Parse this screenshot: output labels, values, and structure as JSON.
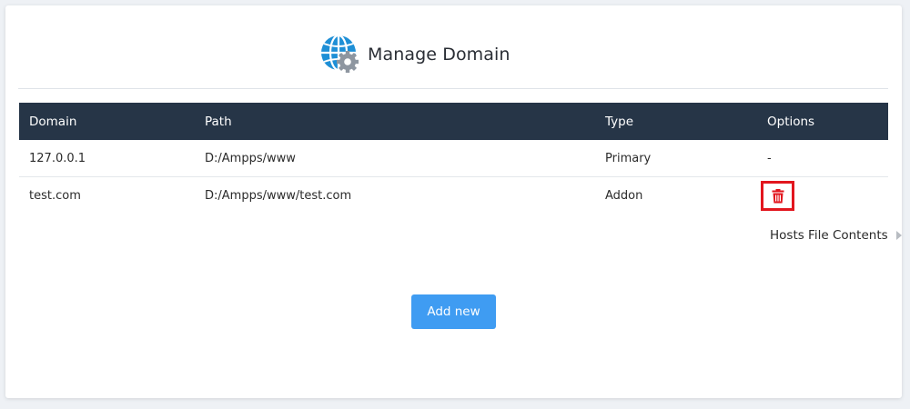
{
  "header": {
    "title": "Manage Domain",
    "icon": "globe-gear-icon"
  },
  "table": {
    "columns": [
      "Domain",
      "Path",
      "Type",
      "Options"
    ],
    "rows": [
      {
        "domain": "127.0.0.1",
        "path": "D:/Ampps/www",
        "type": "Primary",
        "options": "-"
      },
      {
        "domain": "test.com",
        "path": "D:/Ampps/www/test.com",
        "type": "Addon",
        "options": "delete-icon"
      }
    ]
  },
  "hosts_link": {
    "label": "Hosts File Contents"
  },
  "add_button": {
    "label": "Add new"
  },
  "colors": {
    "table_header_bg": "#263547",
    "add_button_bg": "#3f9cf2",
    "delete_accent": "#e2161e",
    "globe_blue": "#1e8fd6"
  }
}
